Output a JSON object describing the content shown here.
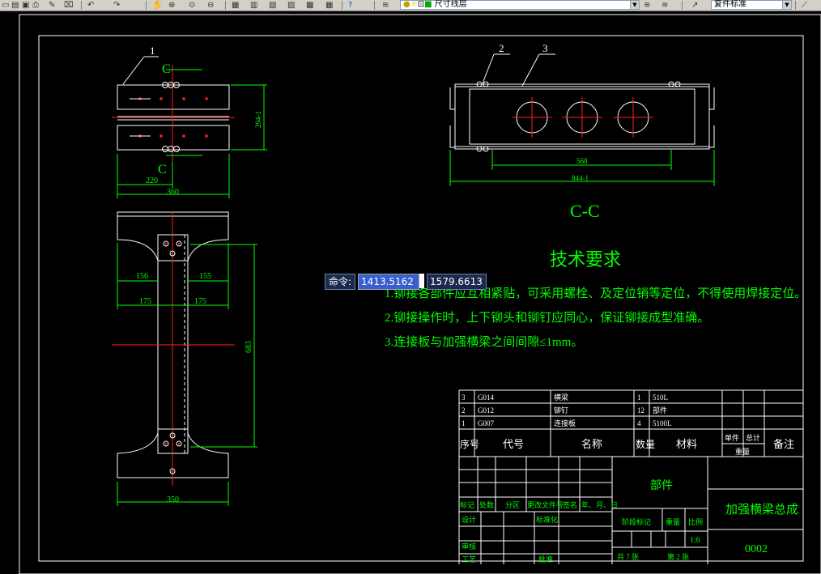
{
  "toolbar": {
    "layer_name": "尺寸线层",
    "dim_style": "复件标准"
  },
  "drawing": {
    "view_left_top": {
      "leader": "1",
      "section": "C",
      "dim_height": "294-1",
      "dim_width_a": "220",
      "dim_width_b": "360"
    },
    "view_left_bottom": {
      "dim_155_a": "156",
      "dim_155_b": "155",
      "dim_175_a": "175",
      "dim_175_b": "175",
      "dim_height": "683",
      "dim_bottom": "350"
    },
    "view_right": {
      "leader_2": "2",
      "leader_3": "3",
      "dim_inner": "568",
      "dim_outer": "844-1",
      "section_label": "C-C"
    },
    "tech": {
      "title": "技术要求",
      "line1": "1.铆接各部件应互相紧贴，可采用螺栓、及定位销等定位，不得使用焊接定位。",
      "line2": "2.铆接操作时，上下铆头和铆钉应同心，保证铆接成型准确。",
      "line3": "3.连接板与加强横梁之间间隙≤1mm。"
    },
    "parts": [
      {
        "no": "3",
        "code": "G014",
        "name": "横梁",
        "qty": "1",
        "material": "510L"
      },
      {
        "no": "2",
        "code": "G012",
        "name": "铆钉",
        "qty": "12",
        "material": "部件"
      },
      {
        "no": "1",
        "code": "G007",
        "name": "连接板",
        "qty": "4",
        "material": "5100L"
      }
    ],
    "header": {
      "no": "序号",
      "code": "代号",
      "name": "名称",
      "qty": "数量",
      "material": "材料",
      "unit": "单件",
      "total": "总计",
      "weight": "重量",
      "remark": "备注"
    },
    "title_block": {
      "part_label": "部件",
      "drawing_name": "加强横梁总成",
      "drawing_no": "0002",
      "mark": "标记",
      "count": "处数",
      "zone": "分区",
      "change_doc": "更改文件号",
      "sign": "签名",
      "date": "年、月、日",
      "design": "设计",
      "standard": "标准化",
      "stage": "阶段标记",
      "weight": "重量",
      "scale": "比例",
      "scale_value": "1:6",
      "review": "审核",
      "process": "工艺",
      "approve": "批准",
      "sheets": "共 7 张",
      "sheet_no": "第 2 张"
    }
  },
  "command": {
    "label": "命令:",
    "x_value": "1413.5162",
    "y_value": "1579.6613"
  },
  "colors": {
    "background": "#000000",
    "line": "#ffffff",
    "dim": "#00ff00",
    "center": "#ff0000",
    "text": "#00ff00"
  }
}
